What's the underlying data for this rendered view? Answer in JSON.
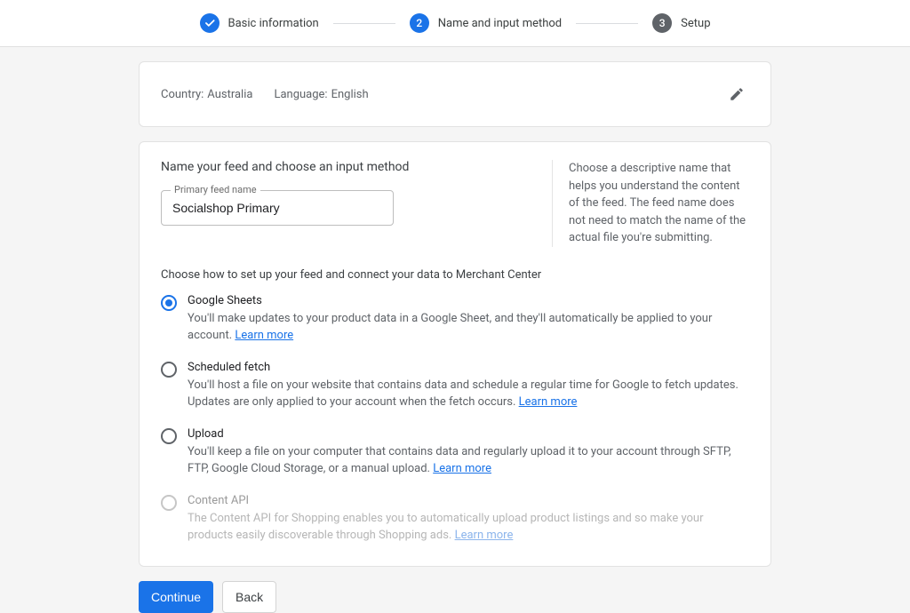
{
  "stepper": {
    "steps": [
      {
        "label": "Basic information",
        "state": "done"
      },
      {
        "label": "Name and input method",
        "state": "active",
        "num": "2"
      },
      {
        "label": "Setup",
        "state": "pending",
        "num": "3"
      }
    ]
  },
  "summary": {
    "country_label": "Country:",
    "country_value": "Australia",
    "language_label": "Language:",
    "language_value": "English"
  },
  "main": {
    "title": "Name your feed and choose an input method",
    "feed_name_label": "Primary feed name",
    "feed_name_value": "Socialshop Primary",
    "help_text": "Choose a descriptive name that helps you understand the content of the feed. The feed name does not need to match the name of the actual file you're submitting.",
    "choose_label": "Choose how to set up your feed and connect your data to Merchant Center",
    "options": [
      {
        "title": "Google Sheets",
        "desc": "You'll make updates to your product data in a Google Sheet, and they'll automatically be applied to your account.",
        "learn_more": "Learn more",
        "selected": true
      },
      {
        "title": "Scheduled fetch",
        "desc": "You'll host a file on your website that contains data and schedule a regular time for Google to fetch updates. Updates are only applied to your account when the fetch occurs.",
        "learn_more": "Learn more"
      },
      {
        "title": "Upload",
        "desc": "You'll keep a file on your computer that contains data and regularly upload it to your account through SFTP, FTP, Google Cloud Storage, or a manual upload.",
        "learn_more": "Learn more"
      },
      {
        "title": "Content API",
        "desc": "The Content API for Shopping enables you to automatically upload product listings and so make your products easily discoverable through Shopping ads.",
        "learn_more": "Learn more",
        "disabled": true
      }
    ]
  },
  "buttons": {
    "continue": "Continue",
    "back": "Back"
  }
}
